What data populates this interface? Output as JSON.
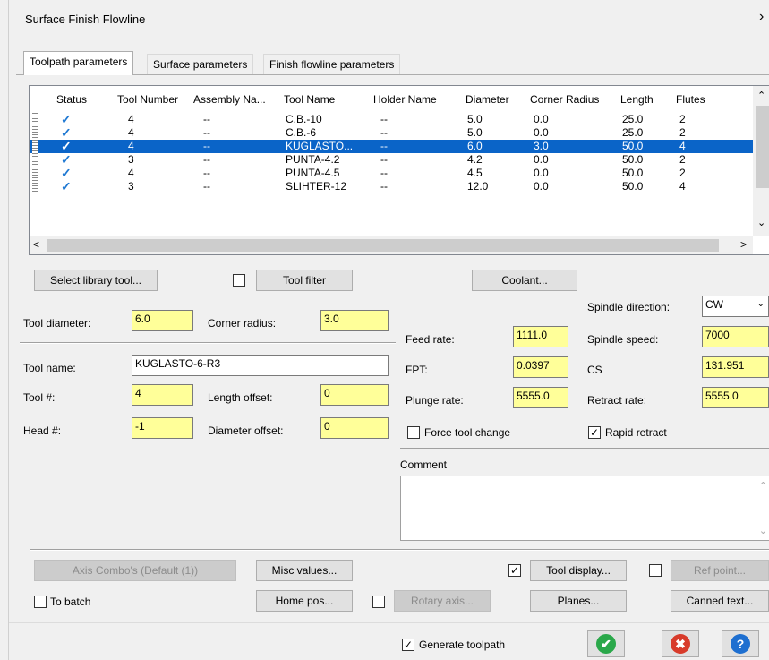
{
  "window": {
    "title": "Surface Finish Flowline",
    "close_glyph": "›"
  },
  "tabs": [
    "Toolpath parameters",
    "Surface parameters",
    "Finish flowline parameters"
  ],
  "table": {
    "headers": [
      "Status",
      "Tool Number",
      "Assembly Na...",
      "Tool Name",
      "Holder Name",
      "Diameter",
      "Corner Radius",
      "Length",
      "Flutes"
    ],
    "rows": [
      {
        "status": "✓",
        "tool_number": "4",
        "assembly": "--",
        "tool_name": "C.B.-10",
        "holder": "--",
        "diameter": "5.0",
        "corner_radius": "0.0",
        "length": "25.0",
        "flutes": "2",
        "selected": false
      },
      {
        "status": "✓",
        "tool_number": "4",
        "assembly": "--",
        "tool_name": "C.B.-6",
        "holder": "--",
        "diameter": "5.0",
        "corner_radius": "0.0",
        "length": "25.0",
        "flutes": "2",
        "selected": false
      },
      {
        "status": "✓",
        "tool_number": "4",
        "assembly": "--",
        "tool_name": "KUGLASTO...",
        "holder": "--",
        "diameter": "6.0",
        "corner_radius": "3.0",
        "length": "50.0",
        "flutes": "4",
        "selected": true
      },
      {
        "status": "✓",
        "tool_number": "3",
        "assembly": "--",
        "tool_name": "PUNTA-4.2",
        "holder": "--",
        "diameter": "4.2",
        "corner_radius": "0.0",
        "length": "50.0",
        "flutes": "2",
        "selected": false
      },
      {
        "status": "✓",
        "tool_number": "4",
        "assembly": "--",
        "tool_name": "PUNTA-4.5",
        "holder": "--",
        "diameter": "4.5",
        "corner_radius": "0.0",
        "length": "50.0",
        "flutes": "2",
        "selected": false
      },
      {
        "status": "✓",
        "tool_number": "3",
        "assembly": "--",
        "tool_name": "SLIHTER-12",
        "holder": "--",
        "diameter": "12.0",
        "corner_radius": "0.0",
        "length": "50.0",
        "flutes": "4",
        "selected": false
      }
    ]
  },
  "buttons": {
    "select_library_tool": "Select library tool...",
    "tool_filter": "Tool filter",
    "coolant": "Coolant...",
    "axis_combo": "Axis Combo's (Default (1))",
    "misc_values": "Misc values...",
    "tool_display": "Tool display...",
    "ref_point": "Ref point...",
    "home_pos": "Home pos...",
    "rotary_axis": "Rotary axis...",
    "planes": "Planes...",
    "canned_text": "Canned text..."
  },
  "fields": {
    "tool_diameter": {
      "label": "Tool diameter:",
      "value": "6.0"
    },
    "corner_radius": {
      "label": "Corner radius:",
      "value": "3.0"
    },
    "tool_name": {
      "label": "Tool name:",
      "value": "KUGLASTO-6-R3"
    },
    "tool_num": {
      "label": "Tool #:",
      "value": "4"
    },
    "length_offset": {
      "label": "Length offset:",
      "value": "0"
    },
    "head_num": {
      "label": "Head #:",
      "value": "-1"
    },
    "diameter_offset": {
      "label": "Diameter offset:",
      "value": "0"
    },
    "feed_rate": {
      "label": "Feed rate:",
      "value": "1111.0"
    },
    "fpt": {
      "label": "FPT:",
      "value": "0.0397"
    },
    "plunge_rate": {
      "label": "Plunge rate:",
      "value": "5555.0"
    },
    "spindle_direction": {
      "label": "Spindle direction:",
      "value": "CW"
    },
    "spindle_speed": {
      "label": "Spindle speed:",
      "value": "7000"
    },
    "cs": {
      "label": "CS",
      "value": "131.951"
    },
    "retract_rate": {
      "label": "Retract rate:",
      "value": "5555.0"
    }
  },
  "checkboxes": {
    "tool_filter": {
      "checked": false
    },
    "force_tool_change": {
      "label": "Force tool change",
      "checked": false
    },
    "rapid_retract": {
      "label": "Rapid retract",
      "checked": true
    },
    "tool_display": {
      "checked": true
    },
    "ref_point": {
      "checked": false
    },
    "to_batch": {
      "label": "To batch",
      "checked": false
    },
    "rotary_axis": {
      "checked": false
    },
    "generate_toolpath": {
      "label": "Generate toolpath",
      "checked": true
    }
  },
  "comment": {
    "label": "Comment",
    "value": ""
  },
  "colors": {
    "selection": "#0a64c8",
    "check": "#1e78d2",
    "field_yellow": "#ffff99",
    "ok_green": "#2aa84a",
    "cancel_red": "#d83b2b",
    "help_blue": "#1e6fd0"
  },
  "icons": {
    "status": "checkmark-icon",
    "ok": "ok-check-icon",
    "cancel": "cancel-x-icon",
    "help": "help-question-icon"
  }
}
